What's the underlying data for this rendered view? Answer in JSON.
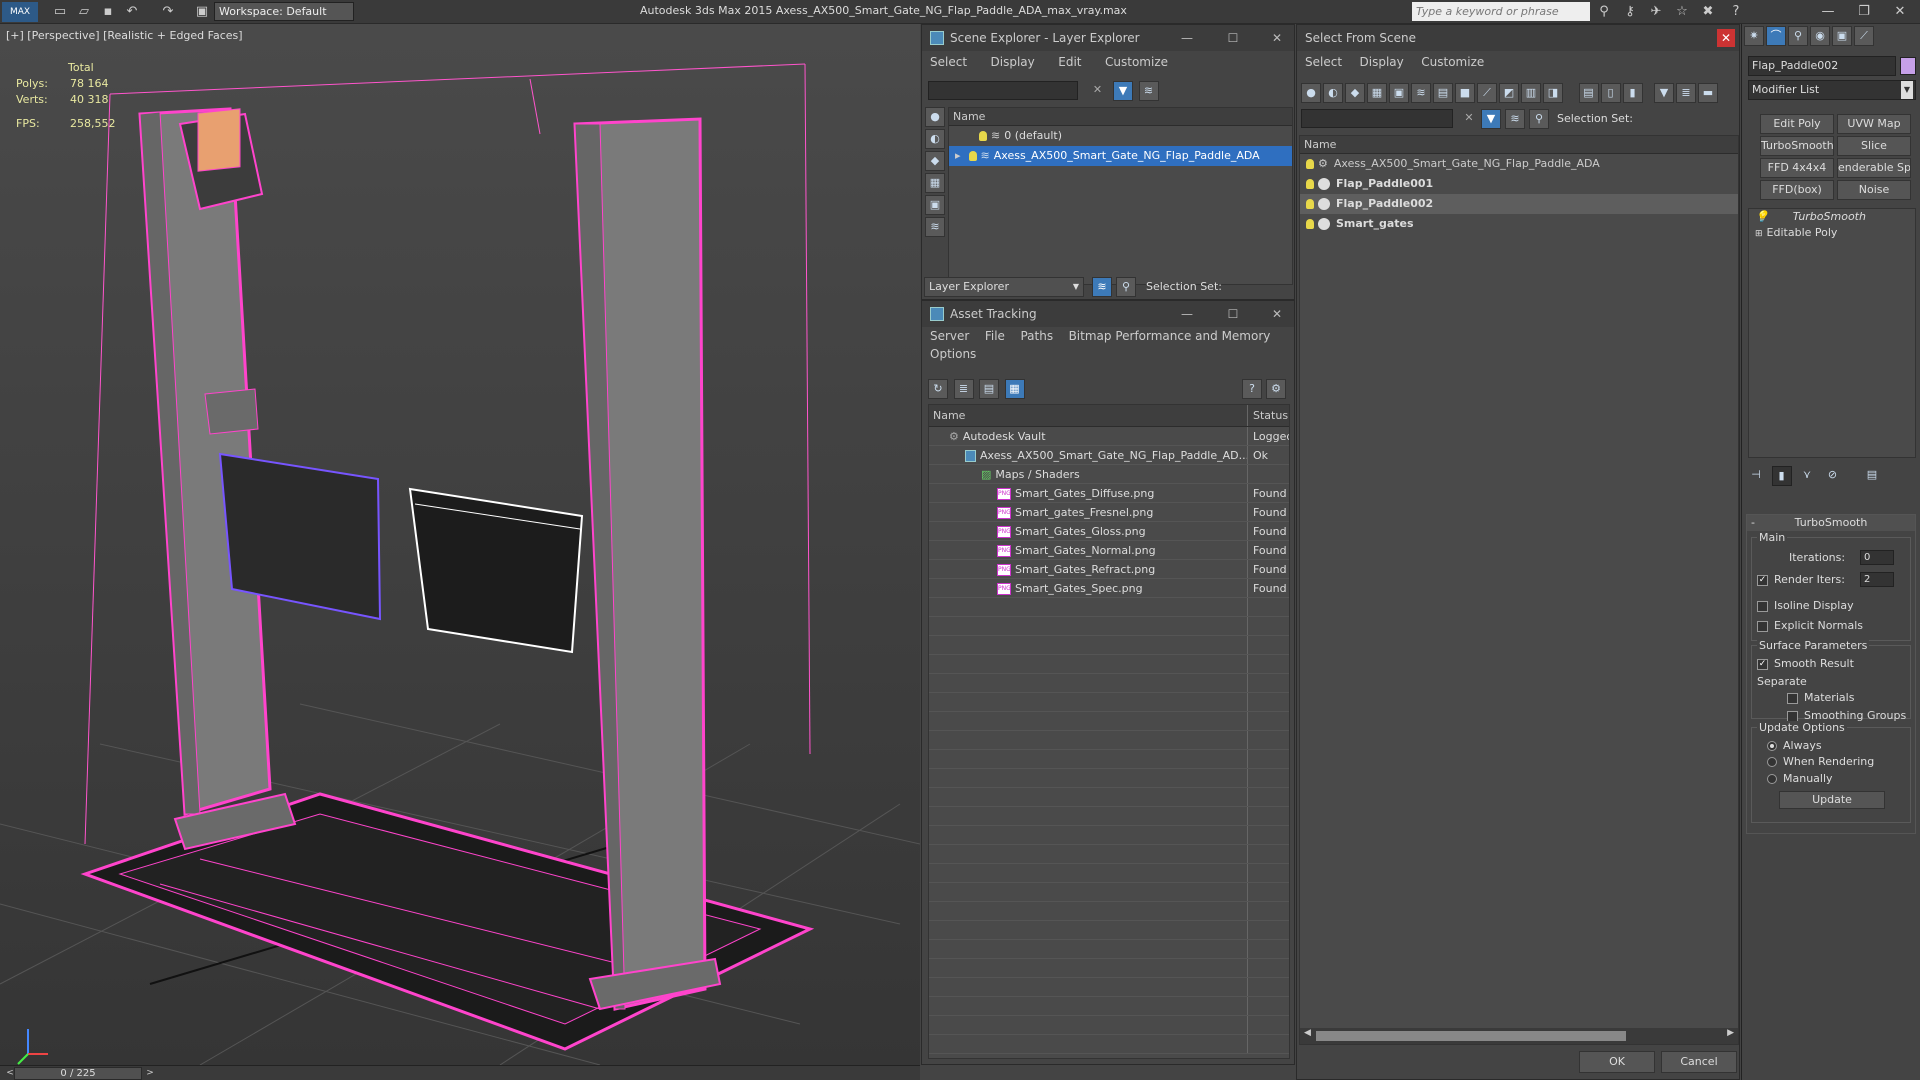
{
  "app": {
    "title": "Autodesk 3ds Max  2015     Axess_AX500_Smart_Gate_NG_Flap_Paddle_ADA_max_vray.max",
    "workspace": "Workspace: Default",
    "search_placeholder": "Type a keyword or phrase"
  },
  "viewport": {
    "label": "[+] [Perspective] [Realistic + Edged Faces]",
    "stats": {
      "total_label": "Total",
      "polys_label": "Polys:",
      "polys": "78 164",
      "verts_label": "Verts:",
      "verts": "40 318",
      "fps_label": "FPS:",
      "fps": "258,552"
    },
    "timeline": "0 / 225"
  },
  "scene_explorer": {
    "title": "Scene Explorer - Layer Explorer",
    "menu": [
      "Select",
      "Display",
      "Edit",
      "Customize"
    ],
    "col_name": "Name",
    "rows": [
      "0 (default)",
      "Axess_AX500_Smart_Gate_NG_Flap_Paddle_ADA"
    ],
    "bottom_dropdown": "Layer Explorer",
    "selection_set": "Selection Set:"
  },
  "asset_tracking": {
    "title": "Asset Tracking",
    "menu": [
      "Server",
      "File",
      "Paths",
      "Bitmap Performance and Memory"
    ],
    "menu2": "Options",
    "col_name": "Name",
    "col_status": "Status",
    "rows": [
      {
        "name": "Autodesk Vault",
        "status": "Logged",
        "indent": 0
      },
      {
        "name": "Axess_AX500_Smart_Gate_NG_Flap_Paddle_AD...",
        "status": "Ok",
        "indent": 1
      },
      {
        "name": "Maps / Shaders",
        "status": "",
        "indent": 2
      },
      {
        "name": "Smart_Gates_Diffuse.png",
        "status": "Found",
        "indent": 3
      },
      {
        "name": "Smart_gates_Fresnel.png",
        "status": "Found",
        "indent": 3
      },
      {
        "name": "Smart_Gates_Gloss.png",
        "status": "Found",
        "indent": 3
      },
      {
        "name": "Smart_Gates_Normal.png",
        "status": "Found",
        "indent": 3
      },
      {
        "name": "Smart_Gates_Refract.png",
        "status": "Found",
        "indent": 3
      },
      {
        "name": "Smart_Gates_Spec.png",
        "status": "Found",
        "indent": 3
      }
    ]
  },
  "select_from_scene": {
    "title": "Select From Scene",
    "menu": [
      "Select",
      "Display",
      "Customize"
    ],
    "selection_set": "Selection Set:",
    "col_name": "Name",
    "rows": [
      "Axess_AX500_Smart_Gate_NG_Flap_Paddle_ADA",
      "Flap_Paddle001",
      "Flap_Paddle002",
      "Smart_gates"
    ],
    "ok": "OK",
    "cancel": "Cancel"
  },
  "command_panel": {
    "object_name": "Flap_Paddle002",
    "modifier_list": "Modifier List",
    "buttons": [
      "Edit Poly",
      "UVW Map",
      "TurboSmooth",
      "Slice",
      "FFD 4x4x4",
      "enderable Splin",
      "FFD(box)",
      "Noise"
    ],
    "stack": [
      "TurboSmooth",
      "Editable Poly"
    ],
    "rollout_title": "TurboSmooth",
    "main_label": "Main",
    "iterations_label": "Iterations:",
    "iterations": "0",
    "render_iters_label": "Render Iters:",
    "render_iters": "2",
    "isoline": "Isoline Display",
    "explicit_normals": "Explicit Normals",
    "surface_params": "Surface Parameters",
    "smooth_result": "Smooth Result",
    "separate": "Separate",
    "materials": "Materials",
    "smoothing_groups": "Smoothing Groups",
    "update_options": "Update Options",
    "always": "Always",
    "when_rendering": "When Rendering",
    "manually": "Manually",
    "update": "Update"
  },
  "colors": {
    "wire": "#ff44cc",
    "selection": "#2f6fc0"
  }
}
